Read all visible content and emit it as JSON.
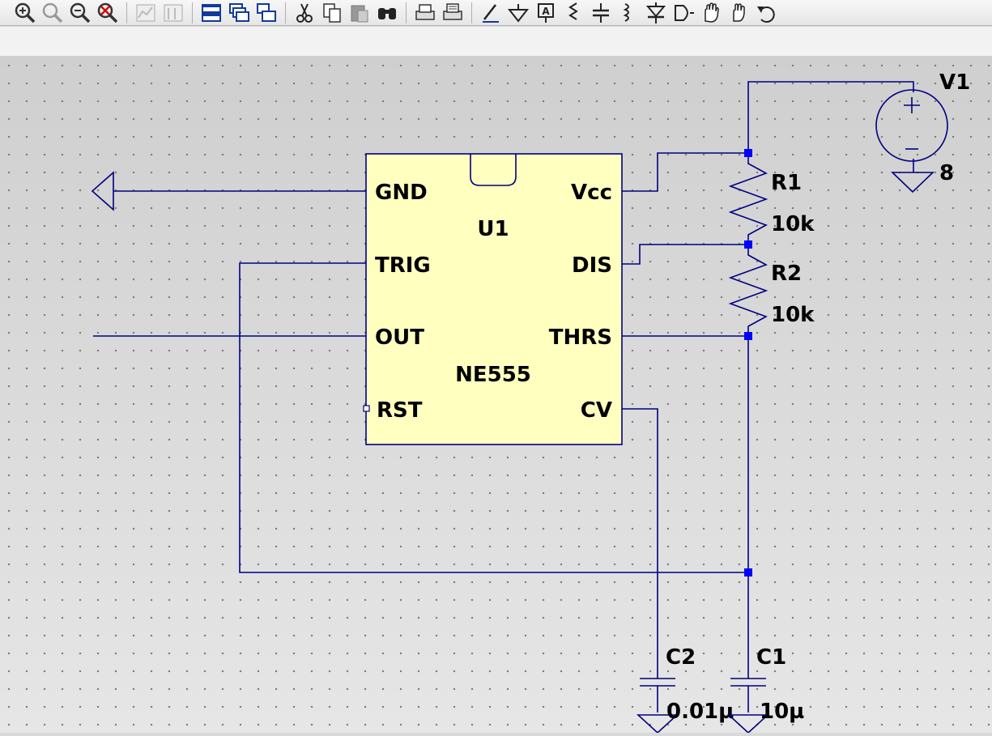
{
  "toolbar": {
    "icons": [
      "zoom-in-icon",
      "zoom-fit-icon",
      "zoom-out-icon",
      "zoom-cancel-icon",
      "plot-icon",
      "plot-settings-icon",
      "tile-horizontal-icon",
      "cascade-icon",
      "tile-vertical-icon",
      "cut-icon",
      "copy-icon",
      "paste-icon",
      "find-icon",
      "print-icon",
      "print-setup-icon",
      "draw-wire-icon",
      "ground-icon",
      "label-net-icon",
      "resistor-icon",
      "capacitor-icon",
      "inductor-icon",
      "diode-icon",
      "component-icon",
      "move-icon",
      "drag-icon",
      "undo-icon"
    ]
  },
  "schematic": {
    "u1": {
      "refdes": "U1",
      "part": "NE555",
      "pins": {
        "gnd": "GND",
        "trig": "TRIG",
        "out": "OUT",
        "rst": "RST",
        "vcc": "Vcc",
        "dis": "DIS",
        "thrs": "THRS",
        "cv": "CV"
      }
    },
    "r1": {
      "refdes": "R1",
      "value": "10k"
    },
    "r2": {
      "refdes": "R2",
      "value": "10k"
    },
    "v1": {
      "refdes": "V1",
      "value": "8"
    },
    "c1": {
      "refdes": "C1",
      "value": "10µ"
    },
    "c2": {
      "refdes": "C2",
      "value": "0.01µ"
    },
    "colors": {
      "wire": "#000080",
      "ic_fill": "#ffffc0",
      "junction": "#0000ff",
      "text": "#000000"
    }
  }
}
